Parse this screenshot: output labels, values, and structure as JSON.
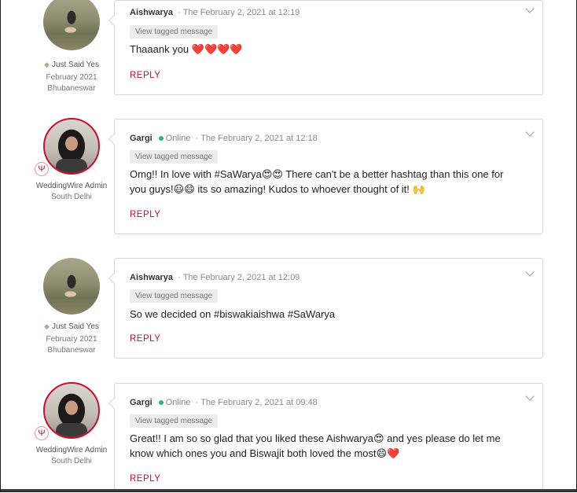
{
  "thread": {
    "messages": [
      {
        "author": "Aishwarya",
        "badge": "Just Said Yes",
        "role": "",
        "date_joined": "February 2021",
        "location": "Bhubaneswar",
        "timestamp": "The February 2, 2021 at 12:19",
        "online": "",
        "tag_label": "View tagged message",
        "text": "Thaaank you ❤️❤️❤️❤️",
        "reply_label": "REPLY"
      },
      {
        "author": "Gargi",
        "badge": "",
        "role": "WeddingWire Admin",
        "date_joined": "",
        "location": "South Delhi",
        "timestamp": "The February 2, 2021 at 12:18",
        "online": "Online",
        "tag_label": "View tagged message",
        "text": "Omg!! In love with #SaWarya😍😍 There can't be a better hashtag than this one for you guys!😃😄 its so amazing! Kudos to whoever thought of it! 🙌",
        "reply_label": "REPLY"
      },
      {
        "author": "Aishwarya",
        "badge": "Just Said Yes",
        "role": "",
        "date_joined": "February 2021",
        "location": "Bhubaneswar",
        "timestamp": "The February 2, 2021 at 12:09",
        "online": "",
        "tag_label": "View tagged message",
        "text": "So we decided on #biswakiaishwa #SaWarya",
        "reply_label": "REPLY"
      },
      {
        "author": "Gargi",
        "badge": "",
        "role": "WeddingWire Admin",
        "date_joined": "",
        "location": "South Delhi",
        "timestamp": "The February 2, 2021 at 09:48",
        "online": "Online",
        "tag_label": "View tagged message",
        "text": "Great!! I am so so glad that you liked these Aishwarya😍 and yes please do let me know which ones you and Biswajit both loved the most😄❤️",
        "reply_label": "REPLY"
      }
    ]
  },
  "icons": {
    "options": "chevron-down-icon",
    "badge": "diamond-icon",
    "admin": "weddingwire-logo-icon"
  },
  "colors": {
    "accent": "#c8102e",
    "online": "#2bb673",
    "card_border": "#d6d6d6"
  }
}
